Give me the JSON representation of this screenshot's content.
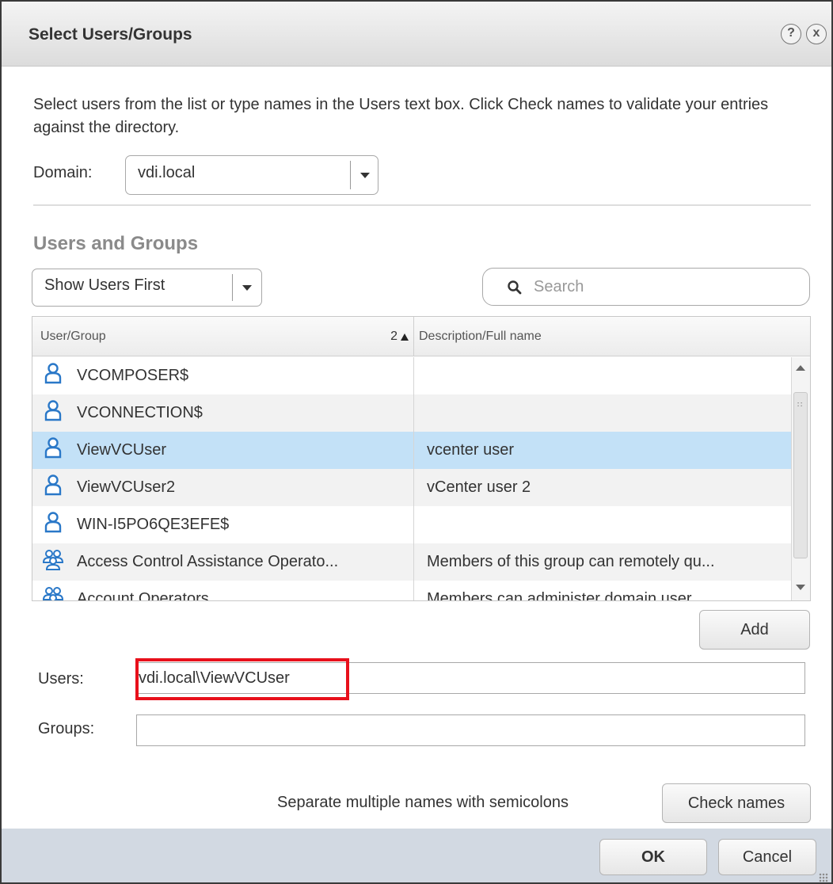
{
  "dialog": {
    "title": "Select Users/Groups",
    "help_glyph": "?",
    "close_glyph": "x",
    "instructions": "Select users from the list or type names in the Users text box. Click Check names to validate your entries against the directory."
  },
  "domain": {
    "label": "Domain:",
    "value": "vdi.local"
  },
  "users_and_groups": {
    "section_title": "Users and Groups",
    "filter_value": "Show Users First",
    "search_placeholder": "Search",
    "columns": {
      "user_group": "User/Group",
      "sort_indicator": "2",
      "description": "Description/Full name"
    },
    "rows": [
      {
        "name": "VCOMPOSER$",
        "description": "",
        "icon": "user-icon",
        "selected": false
      },
      {
        "name": "VCONNECTION$",
        "description": "",
        "icon": "user-icon",
        "selected": false
      },
      {
        "name": "ViewVCUser",
        "description": "vcenter user",
        "icon": "user-icon",
        "selected": true
      },
      {
        "name": "ViewVCUser2",
        "description": "vCenter user 2",
        "icon": "user-icon",
        "selected": false
      },
      {
        "name": "WIN-I5PO6QE3EFE$",
        "description": "",
        "icon": "user-icon",
        "selected": false
      },
      {
        "name": "Access Control Assistance Operato...",
        "description": "Members of this group can remotely qu...",
        "icon": "group-icon",
        "selected": false
      },
      {
        "name": "Account Operators",
        "description": "Members can administer domain user",
        "icon": "group-icon",
        "selected": false
      }
    ],
    "add_label": "Add"
  },
  "form": {
    "users_label": "Users:",
    "users_value": "vdi.local\\ViewVCUser",
    "groups_label": "Groups:",
    "groups_value": "",
    "hint": "Separate multiple names with semicolons",
    "check_names_label": "Check names"
  },
  "footer": {
    "ok_label": "OK",
    "cancel_label": "Cancel"
  },
  "colors": {
    "selected_row": "#c3e1f7",
    "highlight_box": "#e8101b",
    "footer_bg": "#d2d9e2",
    "user_icon": "#2a78c8"
  }
}
